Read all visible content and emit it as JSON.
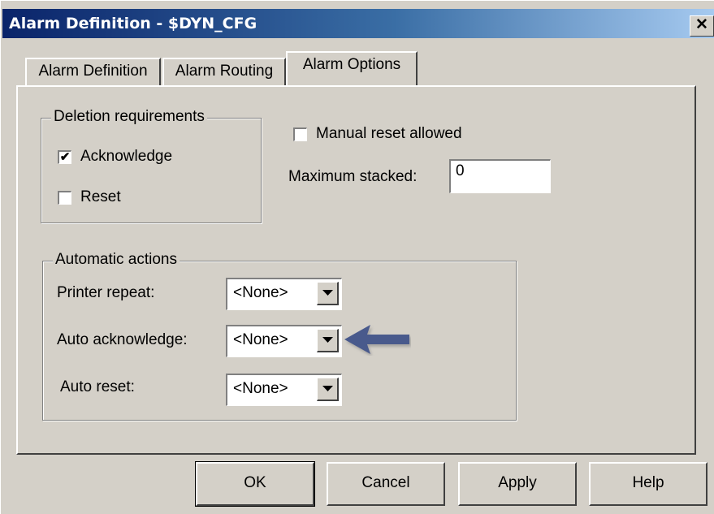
{
  "window": {
    "title": "Alarm Definition - $DYN_CFG",
    "close_label": "✕"
  },
  "tabs": [
    {
      "label": "Alarm Definition"
    },
    {
      "label": "Alarm Routing"
    },
    {
      "label": "Alarm Options",
      "active": true
    }
  ],
  "deletion": {
    "title": "Deletion requirements",
    "acknowledge": {
      "label": "Acknowledge",
      "checked": true,
      "mark": "✔"
    },
    "reset": {
      "label": "Reset",
      "checked": false,
      "mark": ""
    }
  },
  "options": {
    "manual_reset": {
      "label": "Manual reset allowed",
      "checked": false,
      "mark": ""
    },
    "max_stacked": {
      "label": "Maximum stacked:",
      "value": "0"
    }
  },
  "automatic": {
    "title": "Automatic actions",
    "printer_repeat": {
      "label": "Printer repeat:",
      "value": "<None>"
    },
    "auto_acknowledge": {
      "label": "Auto acknowledge:",
      "value": "<None>"
    },
    "auto_reset": {
      "label": "Auto reset:",
      "value": "<None>"
    }
  },
  "annotation": {
    "arrow_color": "#4a5a8c"
  },
  "buttons": {
    "ok": "OK",
    "cancel": "Cancel",
    "apply": "Apply",
    "help": "Help"
  }
}
